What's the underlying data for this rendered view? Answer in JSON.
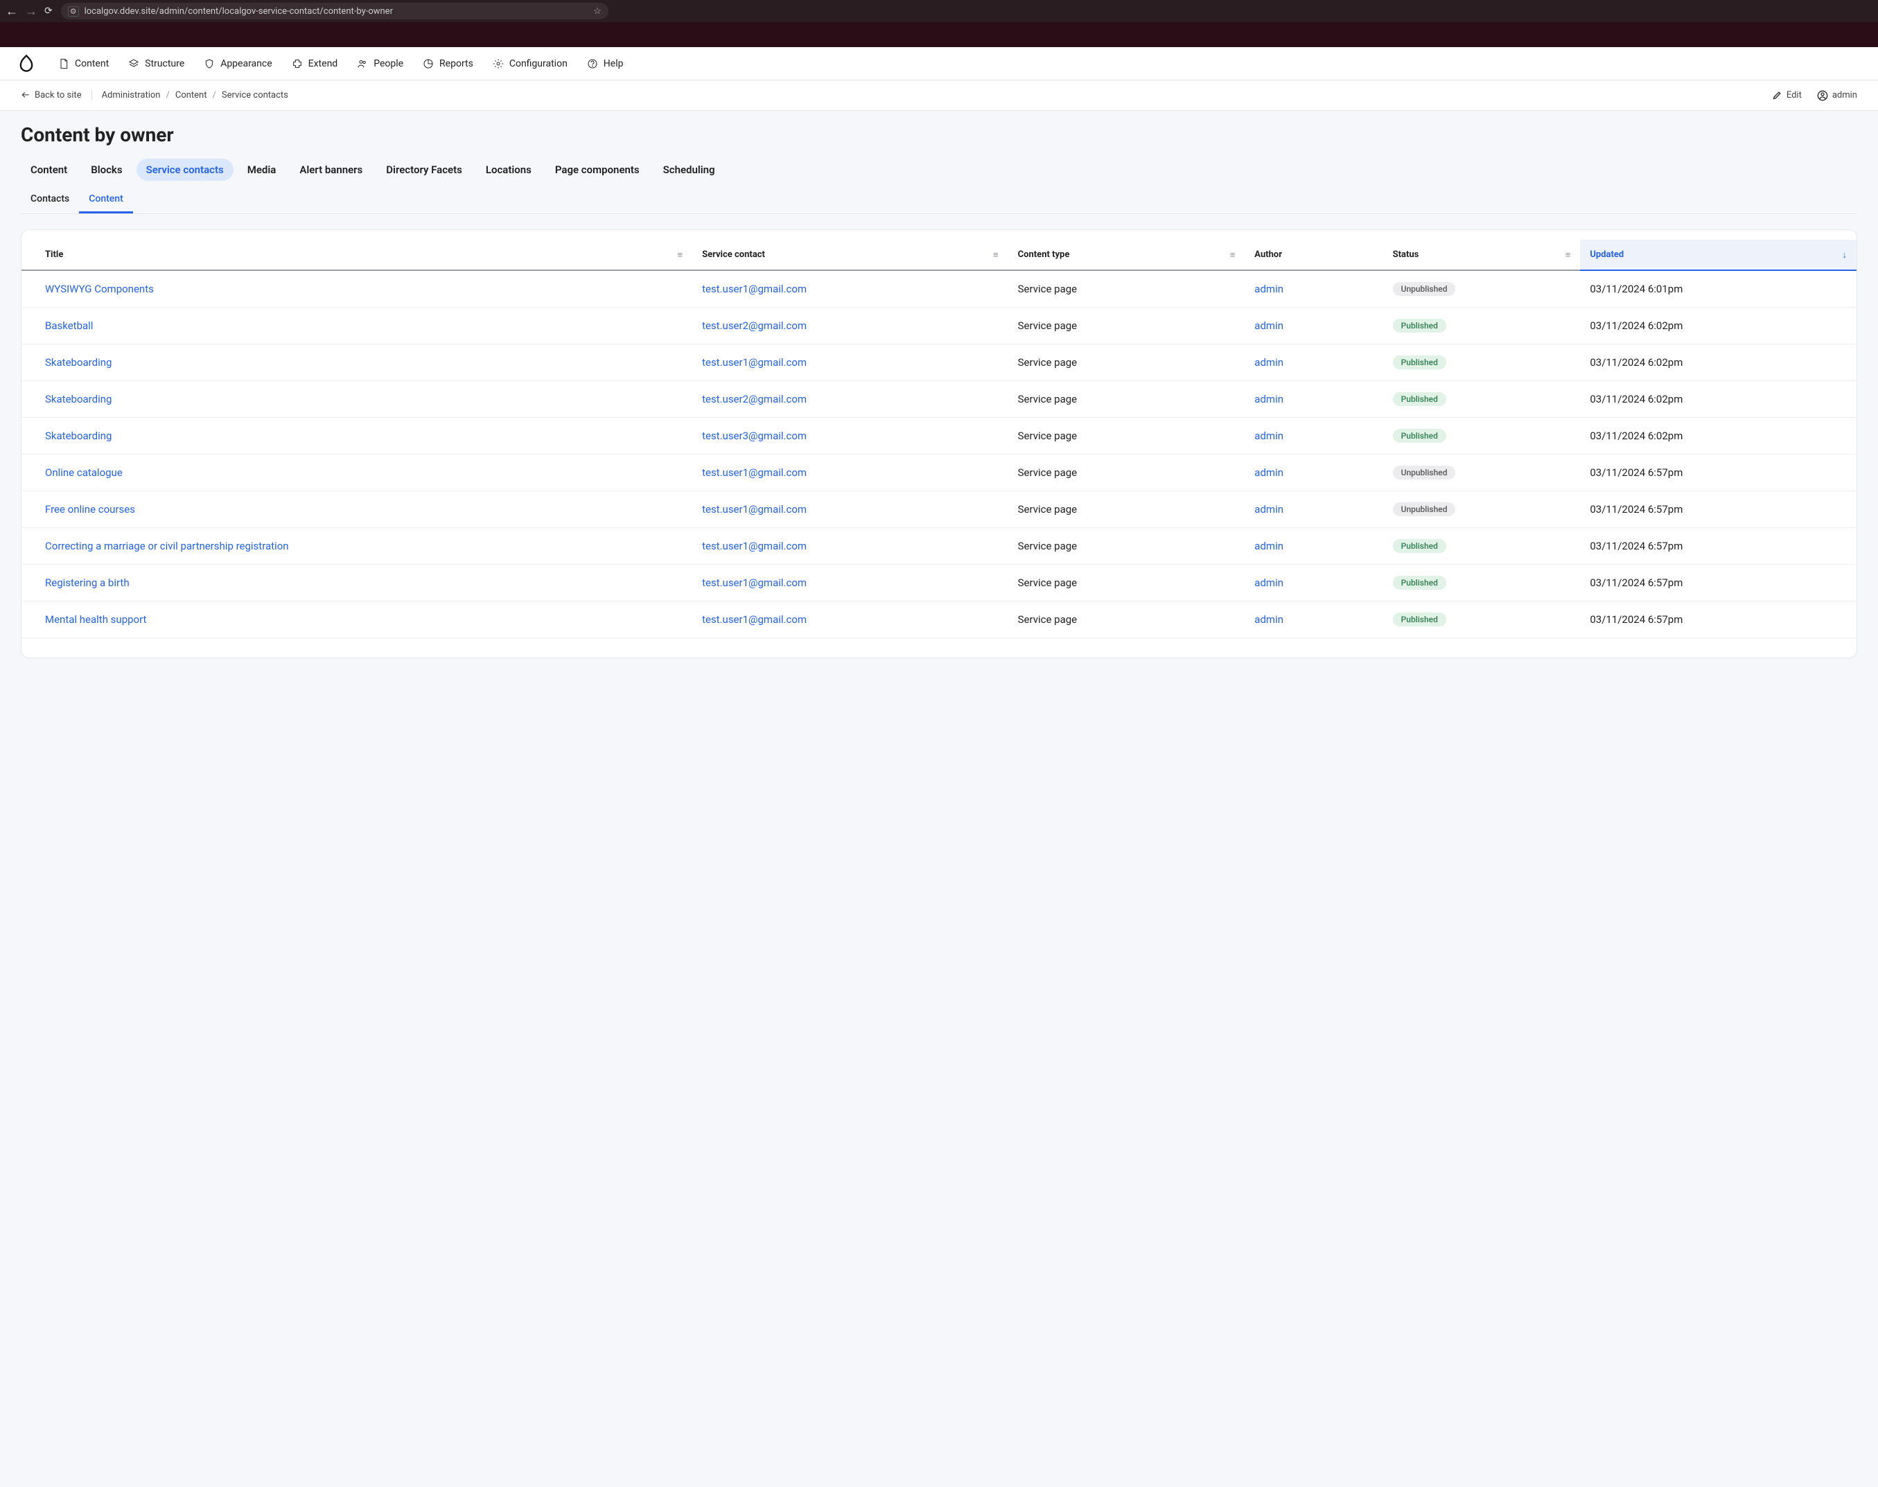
{
  "browser": {
    "url": "localgov.ddev.site/admin/content/localgov-service-contact/content-by-owner"
  },
  "toolbar": {
    "items": [
      {
        "label": "Content"
      },
      {
        "label": "Structure"
      },
      {
        "label": "Appearance"
      },
      {
        "label": "Extend"
      },
      {
        "label": "People"
      },
      {
        "label": "Reports"
      },
      {
        "label": "Configuration"
      },
      {
        "label": "Help"
      }
    ]
  },
  "breadcrumb": {
    "back": "Back to site",
    "items": [
      "Administration",
      "Content",
      "Service contacts"
    ],
    "edit": "Edit",
    "user": "admin"
  },
  "page": {
    "title": "Content by owner"
  },
  "primary_tabs": [
    {
      "label": "Content",
      "active": false
    },
    {
      "label": "Blocks",
      "active": false
    },
    {
      "label": "Service contacts",
      "active": true
    },
    {
      "label": "Media",
      "active": false
    },
    {
      "label": "Alert banners",
      "active": false
    },
    {
      "label": "Directory Facets",
      "active": false
    },
    {
      "label": "Locations",
      "active": false
    },
    {
      "label": "Page components",
      "active": false
    },
    {
      "label": "Scheduling",
      "active": false
    }
  ],
  "secondary_tabs": [
    {
      "label": "Contacts",
      "active": false
    },
    {
      "label": "Content",
      "active": true
    }
  ],
  "table": {
    "columns": [
      {
        "label": "Title",
        "sortable": true
      },
      {
        "label": "Service contact",
        "sortable": true
      },
      {
        "label": "Content type",
        "sortable": true
      },
      {
        "label": "Author",
        "sortable": false
      },
      {
        "label": "Status",
        "sortable": true
      },
      {
        "label": "Updated",
        "sortable": true,
        "sorted": "desc"
      }
    ],
    "rows": [
      {
        "title": "WYSIWYG Components",
        "contact": "test.user1@gmail.com",
        "type": "Service page",
        "author": "admin",
        "status": "Unpublished",
        "updated": "03/11/2024 6:01pm"
      },
      {
        "title": "Basketball",
        "contact": "test.user2@gmail.com",
        "type": "Service page",
        "author": "admin",
        "status": "Published",
        "updated": "03/11/2024 6:02pm"
      },
      {
        "title": "Skateboarding",
        "contact": "test.user1@gmail.com",
        "type": "Service page",
        "author": "admin",
        "status": "Published",
        "updated": "03/11/2024 6:02pm"
      },
      {
        "title": "Skateboarding",
        "contact": "test.user2@gmail.com",
        "type": "Service page",
        "author": "admin",
        "status": "Published",
        "updated": "03/11/2024 6:02pm"
      },
      {
        "title": "Skateboarding",
        "contact": "test.user3@gmail.com",
        "type": "Service page",
        "author": "admin",
        "status": "Published",
        "updated": "03/11/2024 6:02pm"
      },
      {
        "title": "Online catalogue",
        "contact": "test.user1@gmail.com",
        "type": "Service page",
        "author": "admin",
        "status": "Unpublished",
        "updated": "03/11/2024 6:57pm"
      },
      {
        "title": "Free online courses",
        "contact": "test.user1@gmail.com",
        "type": "Service page",
        "author": "admin",
        "status": "Unpublished",
        "updated": "03/11/2024 6:57pm"
      },
      {
        "title": "Correcting a marriage or civil partnership registration",
        "contact": "test.user1@gmail.com",
        "type": "Service page",
        "author": "admin",
        "status": "Published",
        "updated": "03/11/2024 6:57pm"
      },
      {
        "title": "Registering a birth",
        "contact": "test.user1@gmail.com",
        "type": "Service page",
        "author": "admin",
        "status": "Published",
        "updated": "03/11/2024 6:57pm"
      },
      {
        "title": "Mental health support",
        "contact": "test.user1@gmail.com",
        "type": "Service page",
        "author": "admin",
        "status": "Published",
        "updated": "03/11/2024 6:57pm"
      }
    ]
  }
}
